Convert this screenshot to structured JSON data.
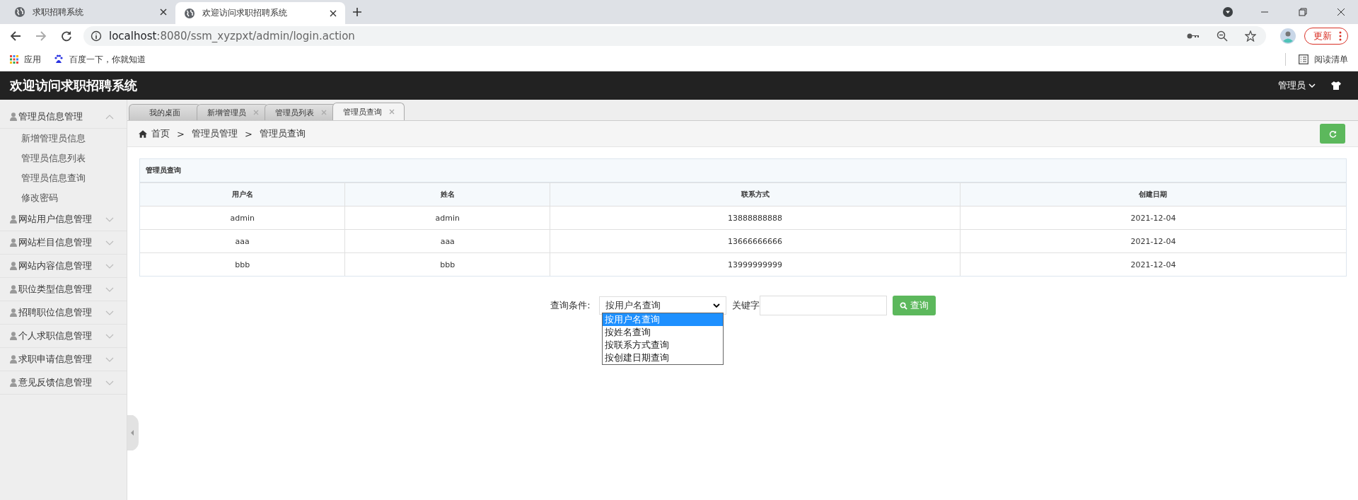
{
  "browser": {
    "tabs": [
      {
        "title": "求职招聘系统",
        "selected": false
      },
      {
        "title": "欢迎访问求职招聘系统",
        "selected": true
      }
    ],
    "url_host": "localhost",
    "url_path": ":8080/ssm_xyzpxt/admin/login.action",
    "update_button": "更新",
    "bookmarks": [
      "应用",
      "百度一下，你就知道"
    ],
    "reading_list": "阅读清单"
  },
  "app": {
    "title": "欢迎访问求职招聘系统",
    "user_menu": "管理员"
  },
  "sidebar": {
    "groups": [
      {
        "label": "管理员信息管理",
        "expanded": true,
        "children": [
          {
            "label": "新增管理员信息"
          },
          {
            "label": "管理员信息列表"
          },
          {
            "label": "管理员信息查询"
          },
          {
            "label": "修改密码"
          }
        ]
      },
      {
        "label": "网站用户信息管理",
        "expanded": false
      },
      {
        "label": "网站栏目信息管理",
        "expanded": false
      },
      {
        "label": "网站内容信息管理",
        "expanded": false
      },
      {
        "label": "职位类型信息管理",
        "expanded": false
      },
      {
        "label": "招聘职位信息管理",
        "expanded": false
      },
      {
        "label": "个人求职信息管理",
        "expanded": false
      },
      {
        "label": "求职申请信息管理",
        "expanded": false
      },
      {
        "label": "意见反馈信息管理",
        "expanded": false
      }
    ]
  },
  "tabs": [
    {
      "label": "我的桌面",
      "selected": false,
      "closable": false
    },
    {
      "label": "新增管理员",
      "selected": false,
      "closable": true
    },
    {
      "label": "管理员列表",
      "selected": false,
      "closable": true
    },
    {
      "label": "管理员查询",
      "selected": true,
      "closable": true
    }
  ],
  "breadcrumb": [
    {
      "label": "首页"
    },
    {
      "separator": ">",
      "label": "管理员管理"
    },
    {
      "separator": ">",
      "label": "管理员查询"
    }
  ],
  "panel": {
    "title": "管理员查询",
    "columns": [
      "用户名",
      "姓名",
      "联系方式",
      "创建日期"
    ],
    "rows": [
      [
        "admin",
        "admin",
        "13888888888",
        "2021-12-04"
      ],
      [
        "aaa",
        "aaa",
        "13666666666",
        "2021-12-04"
      ],
      [
        "bbb",
        "bbb",
        "13999999999",
        "2021-12-04"
      ]
    ]
  },
  "query": {
    "label": "查询条件:",
    "select_value": "按用户名查询",
    "options": [
      {
        "label": "按用户名查询",
        "selected": true
      },
      {
        "label": "按姓名查询",
        "selected": false
      },
      {
        "label": "按联系方式查询",
        "selected": false
      },
      {
        "label": "按创建日期查询",
        "selected": false
      }
    ],
    "keyword_label": "关键字",
    "button": "查询"
  }
}
